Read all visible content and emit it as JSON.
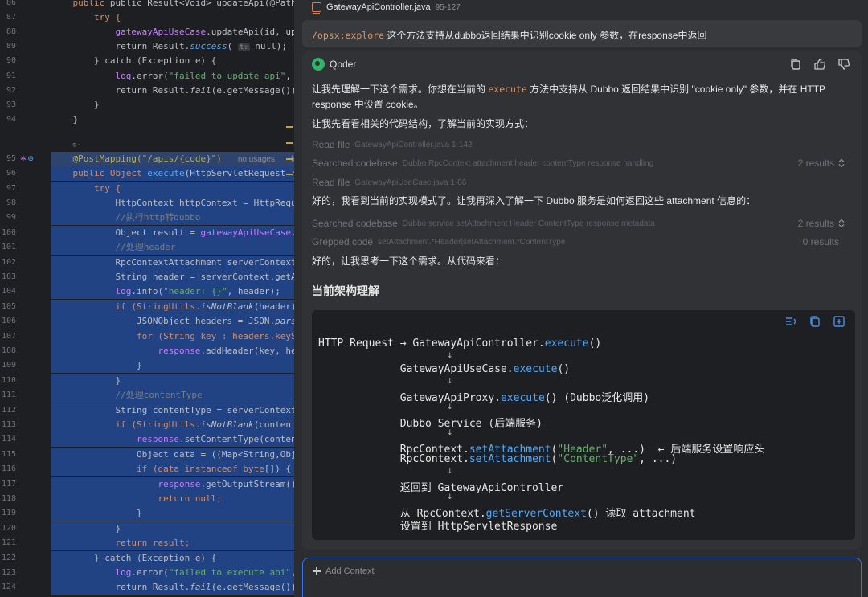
{
  "editor": {
    "line_numbers": [
      "86",
      "87",
      "88",
      "89",
      "90",
      "91",
      "92",
      "93",
      "94",
      "95",
      "96",
      "97",
      "98",
      "99",
      "100",
      "101",
      "102",
      "103",
      "104",
      "105",
      "106",
      "107",
      "108",
      "109",
      "110",
      "111",
      "112",
      "113",
      "114",
      "115",
      "116",
      "117",
      "118",
      "119",
      "120",
      "121",
      "122",
      "123",
      "124"
    ],
    "usages_label": "no usages",
    "usages_more": "fu",
    "hint_t": "t:",
    "fold_marker": "⊕·",
    "lines": {
      "l86": "public Result<Void> updateApi(@PathVariable",
      "l87_kw": "try {",
      "l88_a": "gatewayApiUseCase",
      "l88_b": ".updateApi(id, up",
      "l89_a": "return Result.",
      "l89_b": "success",
      "l89_c": "( ",
      "l89_d": " null);",
      "l90": "} catch (Exception e) {",
      "l91_a": "log",
      "l91_b": ".error(",
      "l91_c": "\"failed to update api\"",
      "l91_d": ", ",
      "l92_a": "return Result.",
      "l92_b": "fail",
      "l92_c": "(e.getMessage())",
      "l93": "}",
      "l94": "}",
      "l96": "@PostMapping(\"/apis/{code}\")",
      "l97_a": "public Object ",
      "l97_b": "execute",
      "l97_c": "(HttpServletRequest r",
      "l98": "try {",
      "l99": "HttpContext httpContext = HttpRequ",
      "l100": "//执行http转dubbo",
      "l101_a": "Object result = ",
      "l101_b": "gatewayApiUseCase",
      "l101_c": ".",
      "l102": "//处理header",
      "l103": "RpcContextAttachment serverContext",
      "l104": "String header = serverContext.getA",
      "l105_a": "log",
      "l105_b": ".info(",
      "l105_c": "\"header: {}\"",
      "l105_d": ", header);",
      "l106_a": "if (StringUtils.",
      "l106_b": "isNotBlank",
      "l106_c": "(header)",
      "l107_a": "JSONObject headers = JSON.",
      "l107_b": "pars",
      "l108_a": "for (String key : headers.keyS",
      "l109_a": "response",
      "l109_b": ".addHeader(key, he",
      "l110": "}",
      "l111": "}",
      "l112": "//处理contentType",
      "l113": "String contentType = serverContext",
      "l114_a": "if (StringUtils.",
      "l114_b": "isNotBlank",
      "l114_c": "(conten",
      "l115_a": "response",
      "l115_b": ".setContentType(conten",
      "l116": "Object data = ((Map<String,Obj",
      "l117_a": "if (data ",
      "l117_b": "instanceof byte",
      "l117_c": "[]) {",
      "l118_a": "response",
      "l118_b": ".getOutputStream()",
      "l119_a": "return null;",
      "l120": "}",
      "l121": "}",
      "l122": "return result;",
      "l123": "} catch (Exception e) {",
      "l124_a": "log",
      "l124_b": ".error(",
      "l124_c": "\"failed to execute api\"",
      "l124_d": ", ",
      "l125_a": "return Result.",
      "l125_b": "fail",
      "l125_c": "(e.getMessage())"
    }
  },
  "panel": {
    "ref_file": "GatewayApiController.java",
    "ref_lines": "95-127",
    "user_command": "/opsx:explore",
    "user_text": " 这个方法支持从dubbo返回结果中识别cookie only 参数，在response中返回",
    "agent_name": "Qoder",
    "p1_a": "让我先理解一下这个需求。你想在当前的 ",
    "p1_code": "execute",
    "p1_b": " 方法中支持从 Dubbo 返回结果中识别 \"cookie only\" 参数，并在 HTTP",
    "p1_c": "response 中设置 cookie。",
    "p2": "让我先看看相关的代码结构，了解当前的实现方式：",
    "tools": [
      {
        "name": "Read file",
        "arg": "GatewayApiController.java 1-142",
        "result": ""
      },
      {
        "name": "Searched codebase",
        "arg": "Dubbo RpcContext attachment header contentType response handling",
        "result": "2 results"
      },
      {
        "name": "Read file",
        "arg": "GatewayApiUseCase.java 1-86",
        "result": ""
      },
      {
        "name": "Searched codebase",
        "arg": "Dubbo service setAttachment Header ContentType response metadata",
        "result": "2 results"
      },
      {
        "name": "Grepped code",
        "arg": "setAttachment.*Header|setAttachment.*ContentType",
        "result": "0 results"
      }
    ],
    "p3": "好的，我看到当前的实现模式了。让我再深入了解一下 Dubbo 服务是如何返回这些 attachment 信息的：",
    "p4": "好的，让我思考一下这个需求。从代码来看：",
    "section_title": "当前架构理解",
    "diagram": {
      "arrow": "↓",
      "l1_a": "HTTP Request → GatewayApiController.",
      "l1_b": "execute",
      "l1_c": "()",
      "l2_a": "GatewayApiUseCase.",
      "l2_b": "execute",
      "l2_c": "()",
      "l3_a": "GatewayApiProxy.",
      "l3_b": "execute",
      "l3_c": "() (Dubbo泛化调用)",
      "l4": "Dubbo Service (后端服务)",
      "l5_a": "RpcContext.",
      "l5_b": "setAttachment",
      "l5_c": "(",
      "l5_d": "\"Header\"",
      "l5_e": ", ...)  ← 后端服务设置响应头",
      "l6_a": "RpcContext.",
      "l6_b": "setAttachment",
      "l6_c": "(",
      "l6_d": "\"ContentType\"",
      "l6_e": ", ...)",
      "l7": "返回到 GatewayApiController",
      "l8_a": "从 RpcContext.",
      "l8_b": "getServerContext",
      "l8_c": "() 读取 attachment",
      "l9": "设置到 HttpServletResponse"
    },
    "add_context": "Add Context"
  },
  "colors": {
    "accent": "#3574f0",
    "selection": "#214283",
    "keyword": "#cf8e6d",
    "method": "#56a8f5",
    "string": "#6aab73"
  },
  "icons": [
    "java-file-icon",
    "qoder-logo-icon",
    "copy-icon",
    "thumbs-up-icon",
    "thumbs-down-icon",
    "chevron-updown-icon",
    "wrap-icon",
    "insert-icon",
    "plus-icon"
  ]
}
